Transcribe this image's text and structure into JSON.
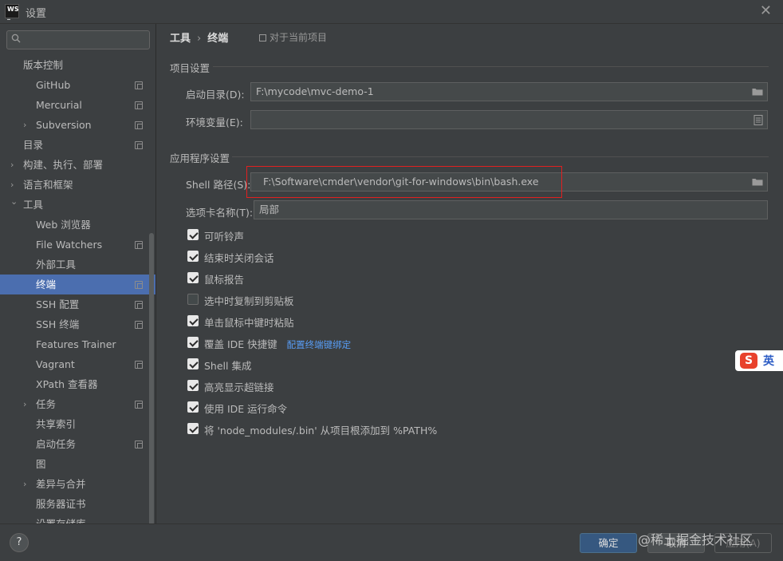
{
  "window": {
    "title": "设置",
    "logo_text": [
      "WS",
      "_"
    ]
  },
  "search": {
    "placeholder": ""
  },
  "sidebar": {
    "items": [
      {
        "label": "版本控制",
        "level": 0,
        "arrow": "",
        "copy": false,
        "selected": false
      },
      {
        "label": "GitHub",
        "level": 1,
        "arrow": "",
        "copy": true,
        "selected": false
      },
      {
        "label": "Mercurial",
        "level": 1,
        "arrow": "",
        "copy": true,
        "selected": false
      },
      {
        "label": "Subversion",
        "level": 1,
        "arrow": "›",
        "copy": true,
        "selected": false
      },
      {
        "label": "目录",
        "level": 0,
        "arrow": "",
        "copy": true,
        "selected": false
      },
      {
        "label": "构建、执行、部署",
        "level": 0,
        "arrow": "›",
        "copy": false,
        "selected": false
      },
      {
        "label": "语言和框架",
        "level": 0,
        "arrow": "›",
        "copy": false,
        "selected": false
      },
      {
        "label": "工具",
        "level": 0,
        "arrow": "⌄",
        "copy": false,
        "selected": false
      },
      {
        "label": "Web 浏览器",
        "level": 1,
        "arrow": "",
        "copy": false,
        "selected": false
      },
      {
        "label": "File Watchers",
        "level": 1,
        "arrow": "",
        "copy": true,
        "selected": false
      },
      {
        "label": "外部工具",
        "level": 1,
        "arrow": "",
        "copy": false,
        "selected": false
      },
      {
        "label": "终端",
        "level": 1,
        "arrow": "",
        "copy": true,
        "selected": true
      },
      {
        "label": "SSH 配置",
        "level": 1,
        "arrow": "",
        "copy": true,
        "selected": false
      },
      {
        "label": "SSH 终端",
        "level": 1,
        "arrow": "",
        "copy": true,
        "selected": false
      },
      {
        "label": "Features Trainer",
        "level": 1,
        "arrow": "",
        "copy": false,
        "selected": false
      },
      {
        "label": "Vagrant",
        "level": 1,
        "arrow": "",
        "copy": true,
        "selected": false
      },
      {
        "label": "XPath 查看器",
        "level": 1,
        "arrow": "",
        "copy": false,
        "selected": false
      },
      {
        "label": "任务",
        "level": 1,
        "arrow": "›",
        "copy": true,
        "selected": false
      },
      {
        "label": "共享索引",
        "level": 1,
        "arrow": "",
        "copy": false,
        "selected": false
      },
      {
        "label": "启动任务",
        "level": 1,
        "arrow": "",
        "copy": true,
        "selected": false
      },
      {
        "label": "图",
        "level": 1,
        "arrow": "",
        "copy": false,
        "selected": false
      },
      {
        "label": "差异与合并",
        "level": 1,
        "arrow": "›",
        "copy": false,
        "selected": false
      },
      {
        "label": "服务器证书",
        "level": 1,
        "arrow": "",
        "copy": false,
        "selected": false
      },
      {
        "label": "设置存储库",
        "level": 1,
        "arrow": "",
        "copy": false,
        "selected": false
      }
    ]
  },
  "breadcrumb": {
    "parent": "工具",
    "separator": "›",
    "current": "终端",
    "note": "对于当前项目"
  },
  "project_settings": {
    "heading": "项目设置",
    "start_dir_label": "启动目录(D):",
    "start_dir_value": "F:\\mycode\\mvc-demo-1",
    "env_label": "环境变量(E):",
    "env_value": ""
  },
  "app_settings": {
    "heading": "应用程序设置",
    "shell_label": "Shell 路径(S):",
    "shell_value": "F:\\Software\\cmder\\vendor\\git-for-windows\\bin\\bash.exe",
    "tab_label": "选项卡名称(T):",
    "tab_value": "局部"
  },
  "checkboxes": [
    {
      "label": "可听铃声",
      "checked": true
    },
    {
      "label": "结束时关闭会话",
      "checked": true
    },
    {
      "label": "鼠标报告",
      "checked": true
    },
    {
      "label": "选中时复制到剪贴板",
      "checked": false
    },
    {
      "label": "单击鼠标中键时粘贴",
      "checked": true
    },
    {
      "label": "覆盖 IDE 快捷键",
      "checked": true,
      "link": "配置终端键绑定"
    },
    {
      "label": "Shell 集成",
      "checked": true
    },
    {
      "label": "高亮显示超链接",
      "checked": true
    },
    {
      "label": "使用 IDE 运行命令",
      "checked": true
    },
    {
      "label": "将 'node_modules/.bin' 从项目根添加到 %PATH%",
      "checked": true
    }
  ],
  "footer": {
    "help": "?",
    "ok": "确定",
    "cancel": "取消",
    "apply": "应用(A)",
    "watermark": "@稀土掘金技术社区"
  },
  "ime": {
    "logo": "S",
    "mode": "英"
  },
  "colors": {
    "selection": "#4b6eaf",
    "highlight_box": "#e02020",
    "link": "#589df6",
    "ok_button": "#365880"
  }
}
